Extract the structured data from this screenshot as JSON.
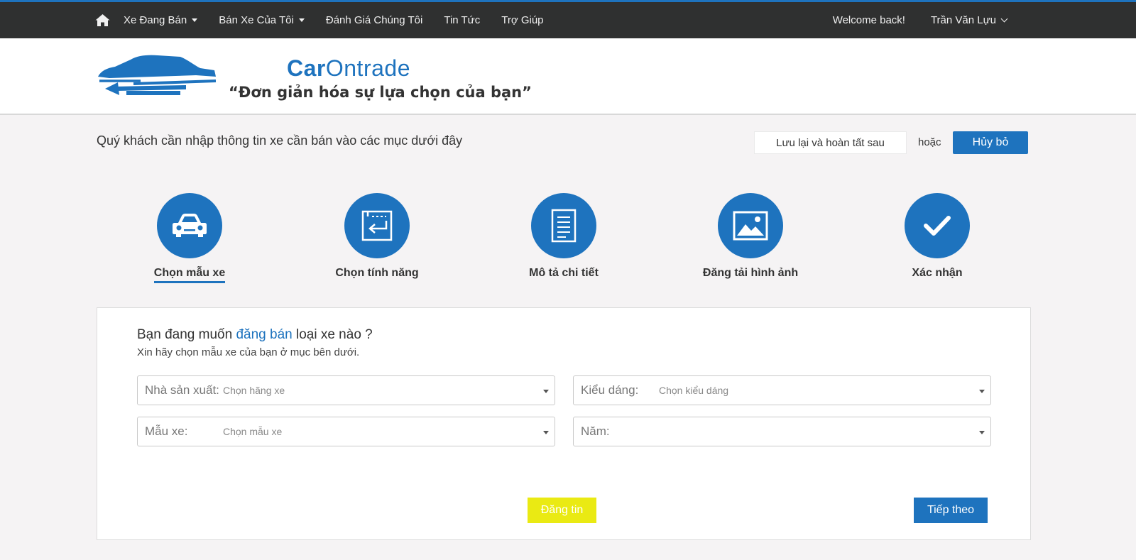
{
  "nav": {
    "home_icon": "home-icon",
    "items": [
      {
        "label": "Xe Đang Bán",
        "dropdown": true
      },
      {
        "label": "Bán Xe Của Tôi",
        "dropdown": true
      },
      {
        "label": "Đánh Giá Chúng Tôi",
        "dropdown": false
      },
      {
        "label": "Tin Tức",
        "dropdown": false
      },
      {
        "label": "Trợ Giúp",
        "dropdown": false
      }
    ],
    "welcome": "Welcome back!",
    "user_name": "Trần Văn Lựu"
  },
  "header": {
    "brand_part1": "Car",
    "brand_part2": "Ontrade",
    "slogan": "“Đơn giản hóa sự lựa chọn của bạn”"
  },
  "intro": {
    "text": "Quý khách cần nhập thông tin xe cần bán vào các mục dưới đây",
    "save_later": "Lưu lại và hoàn tất sau",
    "or": "hoặc",
    "cancel": "Hủy bỏ"
  },
  "steps": [
    {
      "label": "Chọn mẫu xe",
      "icon": "car-icon",
      "active": true
    },
    {
      "label": "Chọn tính năng",
      "icon": "feature-icon",
      "active": false
    },
    {
      "label": "Mô tả chi tiết",
      "icon": "document-icon",
      "active": false
    },
    {
      "label": "Đăng tải hình ảnh",
      "icon": "image-icon",
      "active": false
    },
    {
      "label": "Xác nhận",
      "icon": "check-icon",
      "active": false
    }
  ],
  "form": {
    "title_before": "Bạn đang muốn ",
    "title_highlight": "đăng bán",
    "title_after": " loại xe nào ?",
    "subtitle": "Xin hãy chọn mẫu xe của bạn ở mục bên dưới.",
    "fields": {
      "maker": {
        "label": "Nhà sản xuất:",
        "value": "Chọn hãng xe"
      },
      "body": {
        "label": "Kiểu dáng:",
        "value": "Chọn kiểu dáng"
      },
      "model": {
        "label": "Mẫu xe:",
        "value": "Chọn mẫu xe"
      },
      "year": {
        "label": "Năm:",
        "value": ""
      }
    },
    "post_button": "Đăng tin",
    "next_button": "Tiếp theo"
  },
  "colors": {
    "primary": "#1e73be",
    "nav_bg": "#2f3030",
    "post_button": "#eaea13",
    "page_bg": "#f5f3f4"
  }
}
